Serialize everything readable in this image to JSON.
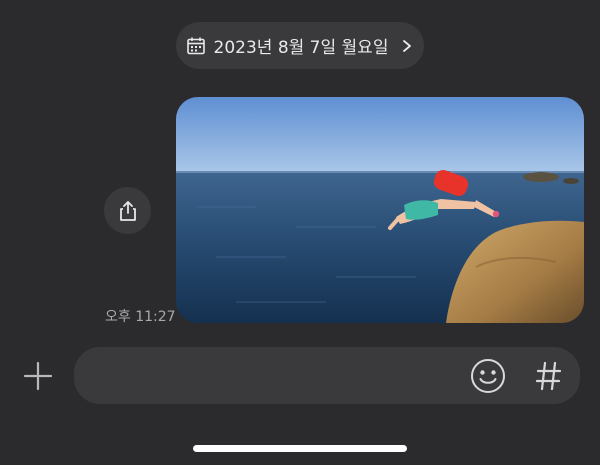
{
  "header": {
    "date_label": "2023년 8월 7일 월요일",
    "calendar_icon": "calendar-icon",
    "chevron_icon": "chevron-right-icon"
  },
  "message": {
    "timestamp": "오후 11:27",
    "share_icon": "share-icon",
    "photo_alt": "photo-attachment"
  },
  "composer": {
    "plus_icon": "plus-icon",
    "input_value": "",
    "emoji_icon": "emoji-icon",
    "hashtag_icon": "hashtag-icon"
  },
  "colors": {
    "background": "#2b2b2d",
    "surface": "#3a3a3d",
    "text": "#e9e9ea",
    "muted": "#a9a9ad"
  }
}
